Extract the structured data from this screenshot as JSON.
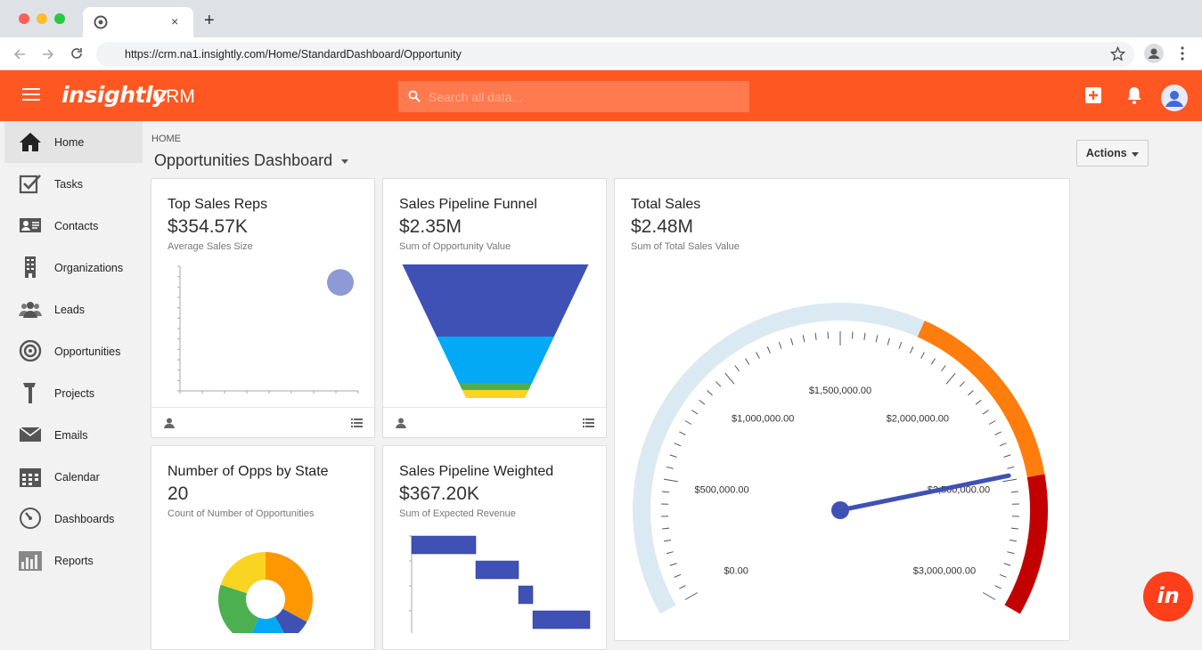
{
  "browser": {
    "url": "https://crm.na1.insightly.com/Home/StandardDashboard/Opportunity",
    "tab_close": "×",
    "new_tab": "+"
  },
  "header": {
    "brand": "insightly",
    "app_name": "CRM",
    "search_placeholder": "Search all data..."
  },
  "sidebar": {
    "items": [
      {
        "label": "Home",
        "icon": "home-icon",
        "active": true
      },
      {
        "label": "Tasks",
        "icon": "tasks-icon"
      },
      {
        "label": "Contacts",
        "icon": "contacts-icon"
      },
      {
        "label": "Organizations",
        "icon": "organizations-icon"
      },
      {
        "label": "Leads",
        "icon": "leads-icon"
      },
      {
        "label": "Opportunities",
        "icon": "opportunities-icon"
      },
      {
        "label": "Projects",
        "icon": "projects-icon"
      },
      {
        "label": "Emails",
        "icon": "emails-icon"
      },
      {
        "label": "Calendar",
        "icon": "calendar-icon"
      },
      {
        "label": "Dashboards",
        "icon": "dashboards-icon"
      },
      {
        "label": "Reports",
        "icon": "reports-icon"
      }
    ]
  },
  "main": {
    "breadcrumb": "HOME",
    "title": "Opportunities Dashboard",
    "actions_label": "Actions"
  },
  "cards": {
    "top_sales_reps": {
      "title": "Top Sales Reps",
      "value": "$354.57K",
      "subtitle": "Average Sales Size"
    },
    "pipeline_funnel": {
      "title": "Sales Pipeline Funnel",
      "value": "$2.35M",
      "subtitle": "Sum of Opportunity Value"
    },
    "total_sales": {
      "title": "Total Sales",
      "value": "$2.48M",
      "subtitle": "Sum of Total Sales Value"
    },
    "opps_by_state": {
      "title": "Number of Opps by State",
      "value": "20",
      "subtitle": "Count of Number of Opportunities"
    },
    "pipeline_weighted": {
      "title": "Sales Pipeline Weighted",
      "value": "$367.20K",
      "subtitle": "Sum of Expected Revenue"
    }
  },
  "chart_data": [
    {
      "type": "scatter",
      "title": "Top Sales Reps",
      "series": [
        {
          "points": [
            {
              "x": 0.9,
              "y": 0.87
            }
          ]
        }
      ],
      "point_color": "#8f99d6"
    },
    {
      "type": "funnel",
      "title": "Sales Pipeline Funnel",
      "segments": [
        {
          "value": 0.54,
          "color": "#3f51b5"
        },
        {
          "value": 0.35,
          "color": "#03a9f4"
        },
        {
          "value": 0.05,
          "color": "#4caf50"
        },
        {
          "value": 0.06,
          "color": "#f9d423"
        }
      ]
    },
    {
      "type": "gauge",
      "title": "Total Sales",
      "min": 0,
      "max": 3000000,
      "value": 2480000,
      "tick_labels": [
        "$0.00",
        "$500,000.00",
        "$1,000,000.00",
        "$1,500,000.00",
        "$2,000,000.00",
        "$2,500,000.00",
        "$3,000,000.00"
      ],
      "bands": [
        {
          "from": 0,
          "to": 1800000,
          "color": "#dbe9f2"
        },
        {
          "from": 1800000,
          "to": 2500000,
          "color": "#ff7d0c"
        },
        {
          "from": 2500000,
          "to": 3000000,
          "color": "#c30000"
        }
      ],
      "needle_color": "#3f51b5"
    },
    {
      "type": "pie",
      "title": "Number of Opps by State",
      "slices": [
        {
          "value": 0.33,
          "color": "#ff9800"
        },
        {
          "value": 0.09,
          "color": "#3f51b5"
        },
        {
          "value": 0.14,
          "color": "#03a9f4"
        },
        {
          "value": 0.24,
          "color": "#4caf50"
        },
        {
          "value": 0.2,
          "color": "#f9d423"
        }
      ]
    },
    {
      "type": "bar",
      "title": "Sales Pipeline Weighted",
      "orientation": "horizontal-waterfall",
      "values": [
        0.36,
        0.24,
        0.08,
        0.33
      ],
      "bar_color": "#3f51b5"
    }
  ]
}
